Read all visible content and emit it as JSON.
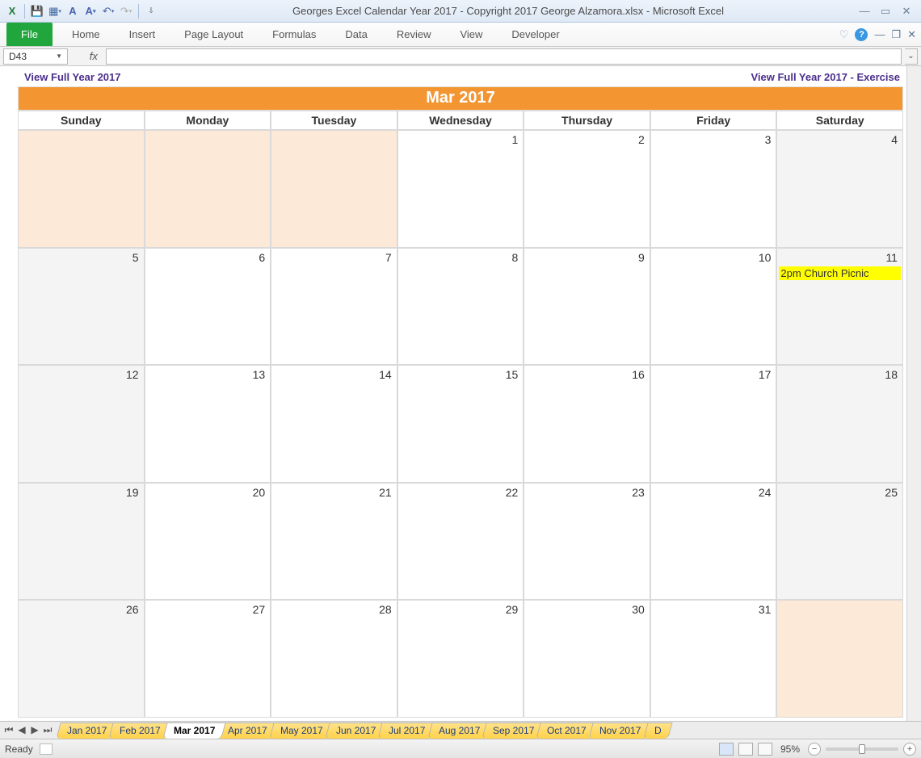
{
  "app_title": "Georges Excel Calendar Year 2017  -  Copyright 2017 George Alzamora.xlsx  -  Microsoft Excel",
  "qat": {
    "icons": [
      "excel-icon",
      "save-icon",
      "calendar-icon",
      "find-icon",
      "find-replace-icon",
      "undo-icon",
      "redo-icon",
      "customize-icon"
    ]
  },
  "ribbon": {
    "file": "File",
    "tabs": [
      "Home",
      "Insert",
      "Page Layout",
      "Formulas",
      "Data",
      "Review",
      "View",
      "Developer"
    ]
  },
  "formula_bar": {
    "cell_ref": "D43",
    "fx_label": "fx",
    "formula": ""
  },
  "links": {
    "left": "View Full Year 2017",
    "right": "View Full Year 2017 - Exercise"
  },
  "calendar": {
    "title": "Mar 2017",
    "dow": [
      "Sunday",
      "Monday",
      "Tuesday",
      "Wednesday",
      "Thursday",
      "Friday",
      "Saturday"
    ],
    "cells": [
      {
        "num": "",
        "cls": "other-month"
      },
      {
        "num": "",
        "cls": "other-month"
      },
      {
        "num": "",
        "cls": "other-month"
      },
      {
        "num": "1",
        "cls": ""
      },
      {
        "num": "2",
        "cls": ""
      },
      {
        "num": "3",
        "cls": ""
      },
      {
        "num": "4",
        "cls": "weekend"
      },
      {
        "num": "5",
        "cls": "weekend"
      },
      {
        "num": "6",
        "cls": ""
      },
      {
        "num": "7",
        "cls": ""
      },
      {
        "num": "8",
        "cls": ""
      },
      {
        "num": "9",
        "cls": ""
      },
      {
        "num": "10",
        "cls": ""
      },
      {
        "num": "11",
        "cls": "weekend",
        "event": "2pm Church Picnic"
      },
      {
        "num": "12",
        "cls": "weekend"
      },
      {
        "num": "13",
        "cls": ""
      },
      {
        "num": "14",
        "cls": ""
      },
      {
        "num": "15",
        "cls": ""
      },
      {
        "num": "16",
        "cls": ""
      },
      {
        "num": "17",
        "cls": ""
      },
      {
        "num": "18",
        "cls": "weekend"
      },
      {
        "num": "19",
        "cls": "weekend"
      },
      {
        "num": "20",
        "cls": ""
      },
      {
        "num": "21",
        "cls": ""
      },
      {
        "num": "22",
        "cls": ""
      },
      {
        "num": "23",
        "cls": ""
      },
      {
        "num": "24",
        "cls": ""
      },
      {
        "num": "25",
        "cls": "weekend"
      },
      {
        "num": "26",
        "cls": "weekend"
      },
      {
        "num": "27",
        "cls": ""
      },
      {
        "num": "28",
        "cls": ""
      },
      {
        "num": "29",
        "cls": ""
      },
      {
        "num": "30",
        "cls": ""
      },
      {
        "num": "31",
        "cls": ""
      },
      {
        "num": "",
        "cls": "other-month"
      }
    ]
  },
  "sheet_tabs": [
    "Jan 2017",
    "Feb 2017",
    "Mar 2017",
    "Apr 2017",
    "May 2017",
    "Jun 2017",
    "Jul 2017",
    "Aug 2017",
    "Sep 2017",
    "Oct 2017",
    "Nov 2017"
  ],
  "sheet_tabs_active": "Mar 2017",
  "sheet_tabs_overflow": "D",
  "status": {
    "ready": "Ready",
    "zoom": "95%"
  }
}
